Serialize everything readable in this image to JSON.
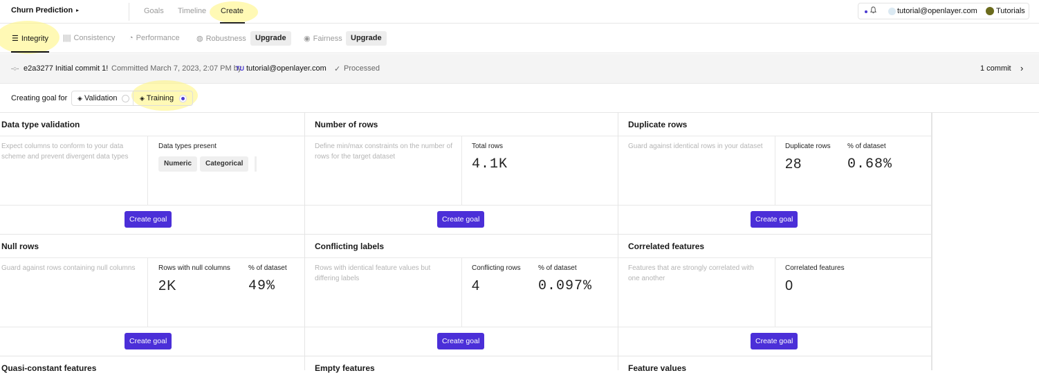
{
  "topbar": {
    "project": "Churn Prediction",
    "project_caret": "▸",
    "tabs": [
      "Goals",
      "Timeline",
      "Create"
    ],
    "bell_icon": "🔔",
    "email": "tutorial@openlayer.com",
    "tutorials": "Tutorials",
    "accent": "#4b2fd8"
  },
  "subtabs": {
    "integrity": "Integrity",
    "consistency": "Consistency",
    "performance": "Performance",
    "robustness": "Robustness",
    "upgrade": "Upgrade",
    "fairness": "Fairness"
  },
  "commit": {
    "icon": "-○-",
    "hash_message": "e2a3277 Initial commit 1!",
    "committed": "Committed March 7, 2023, 2:07 PM by",
    "initials": "TU",
    "author": "tutorial@openlayer.com",
    "check": "✓",
    "status": "Processed",
    "count": "1 commit",
    "chevron": "›"
  },
  "goal_for": {
    "label": "Creating goal for",
    "validation": "Validation",
    "training": "Training",
    "selected": "Training"
  },
  "cards": {
    "dtype": {
      "title": "Data type validation",
      "desc": "Expect columns to conform to your data scheme and prevent divergent data types",
      "metric_label": "Data types present",
      "chips": [
        "Numeric",
        "Categorical"
      ],
      "button": "Create goal"
    },
    "rows": {
      "title": "Number of rows",
      "desc": "Define min/max constraints on the number of rows for the target dataset",
      "metric_label": "Total rows",
      "metric_value": "4.1K",
      "button": "Create goal"
    },
    "dup": {
      "title": "Duplicate rows",
      "desc": "Guard against identical rows in your dataset",
      "metric_label": "Duplicate rows",
      "metric_value": "28",
      "pct_label": "% of dataset",
      "pct_value": "0.68%",
      "button": "Create goal"
    },
    "null": {
      "title": "Null rows",
      "desc": "Guard against rows containing null columns",
      "metric_label": "Rows with null columns",
      "metric_value": "2K",
      "pct_label": "% of dataset",
      "pct_value": "49%",
      "button": "Create goal"
    },
    "conflict": {
      "title": "Conflicting labels",
      "desc": "Rows with identical feature values but differing labels",
      "metric_label": "Conflicting rows",
      "metric_value": "4",
      "pct_label": "% of dataset",
      "pct_value": "0.097%",
      "button": "Create goal"
    },
    "corr": {
      "title": "Correlated features",
      "desc": "Features that are strongly correlated with one another",
      "metric_label": "Correlated features",
      "metric_value": "0",
      "button": "Create goal"
    },
    "quasi": {
      "title": "Quasi-constant features"
    },
    "empty": {
      "title": "Empty features"
    },
    "fvalues": {
      "title": "Feature values"
    }
  }
}
